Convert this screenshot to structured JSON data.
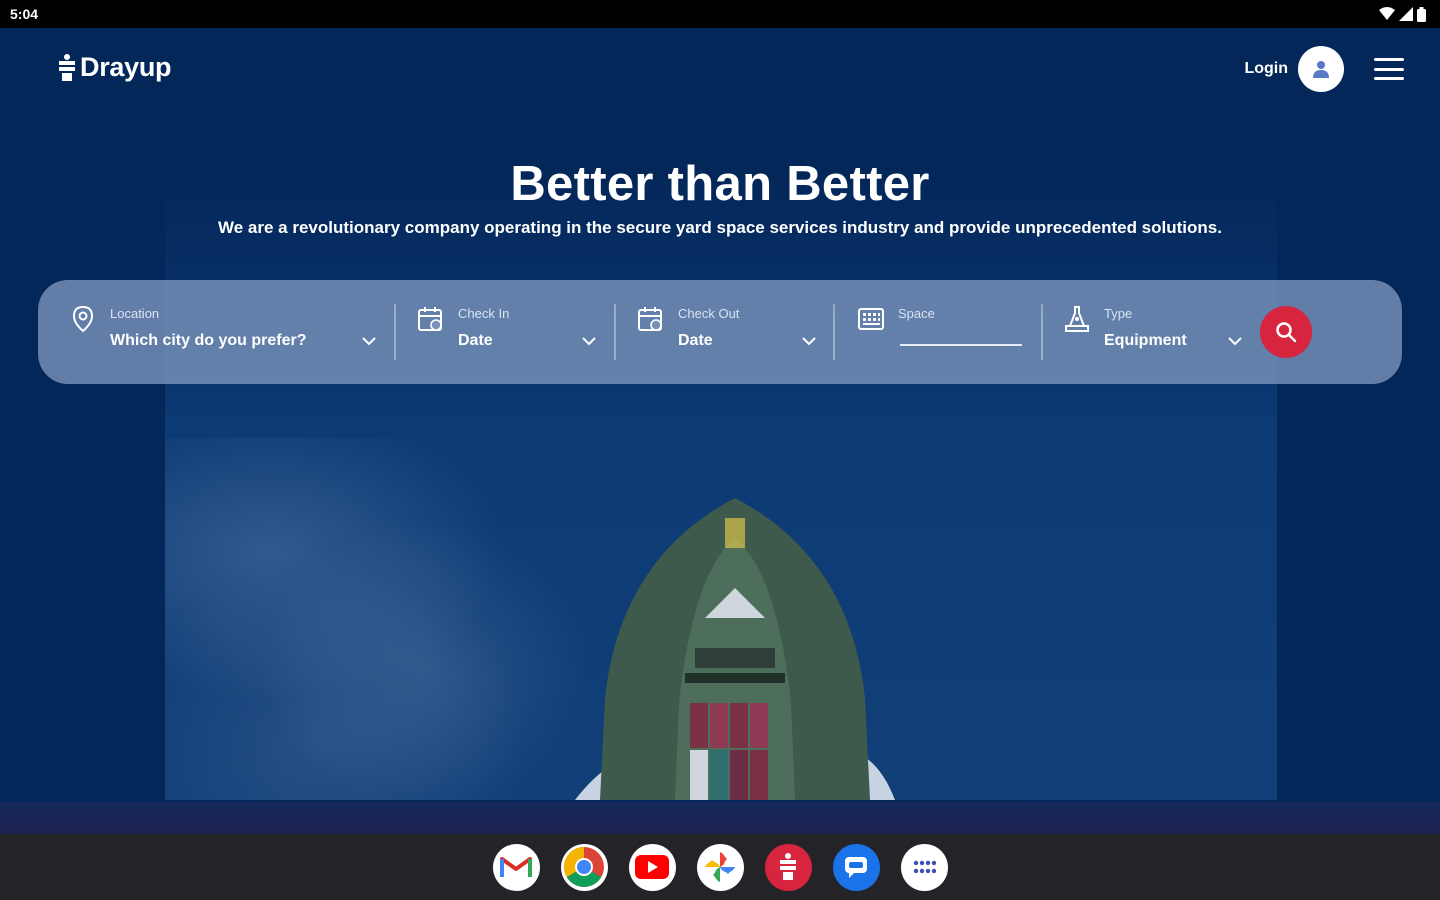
{
  "status_bar": {
    "time": "5:04",
    "icons": [
      "wifi-icon",
      "signal-icon",
      "battery-icon"
    ]
  },
  "nav": {
    "logo_text": "Drayup",
    "login_label": "Login",
    "icons": [
      "user-avatar-icon",
      "hamburger-menu-icon"
    ]
  },
  "hero": {
    "title": "Better than Better",
    "subtitle": "We are a revolutionary company operating in the secure yard space services industry and provide unprecedented solutions."
  },
  "search": {
    "location": {
      "label": "Location",
      "value": "Which city do you prefer?",
      "icon": "map-pin-icon"
    },
    "check_in": {
      "label": "Check In",
      "value": "Date",
      "icon": "calendar-icon"
    },
    "check_out": {
      "label": "Check Out",
      "value": "Date",
      "icon": "calendar-icon"
    },
    "space": {
      "label": "Space",
      "value": "",
      "icon": "grid-keyboard-icon"
    },
    "type": {
      "label": "Type",
      "value": "Equipment",
      "icon": "equipment-icon"
    },
    "search_icon": "search-icon"
  },
  "dock": {
    "apps": [
      "gmail",
      "chrome",
      "youtube",
      "photos",
      "drayup",
      "messages",
      "app-drawer"
    ]
  },
  "colors": {
    "background": "#04275a",
    "search_bar": "#7891b9",
    "search_button": "#d8253f",
    "dock": "#242428"
  }
}
